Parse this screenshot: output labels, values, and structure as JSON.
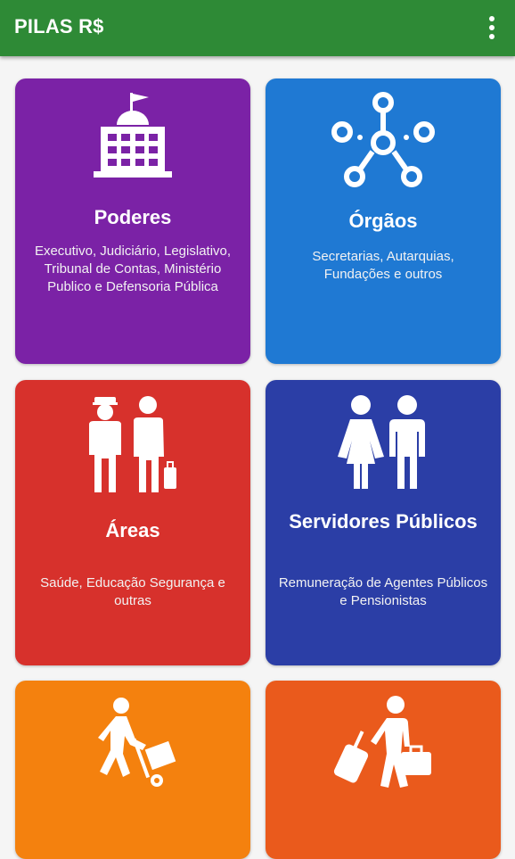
{
  "app": {
    "title": "PILAS R$"
  },
  "colors": {
    "appbar": "#2e8a36",
    "poderes": "#7b22a6",
    "orgaos": "#1f79d3",
    "areas": "#d7312c",
    "servidores": "#2b3ea6",
    "card5": "#f4810e",
    "card6": "#ea5a1c"
  },
  "cards": [
    {
      "title": "Poderes",
      "desc": "Executivo, Judiciário, Legislativo, Tribunal de Contas, Ministério Publico e Defensoria Pública",
      "icon": "government-building-icon"
    },
    {
      "title": "Órgãos",
      "desc": "Secretarias, Autarquias, Fundações e outros",
      "icon": "network-icon"
    },
    {
      "title": "Áreas",
      "desc": "Saúde, Educação Segurança e outras",
      "icon": "workers-icon"
    },
    {
      "title": "Servidores Públicos",
      "desc": "Remuneração de Agentes Públicos e Pensionistas",
      "icon": "people-icon"
    },
    {
      "title": "",
      "desc": "",
      "icon": "hand-truck-icon"
    },
    {
      "title": "",
      "desc": "",
      "icon": "traveler-luggage-icon"
    }
  ]
}
